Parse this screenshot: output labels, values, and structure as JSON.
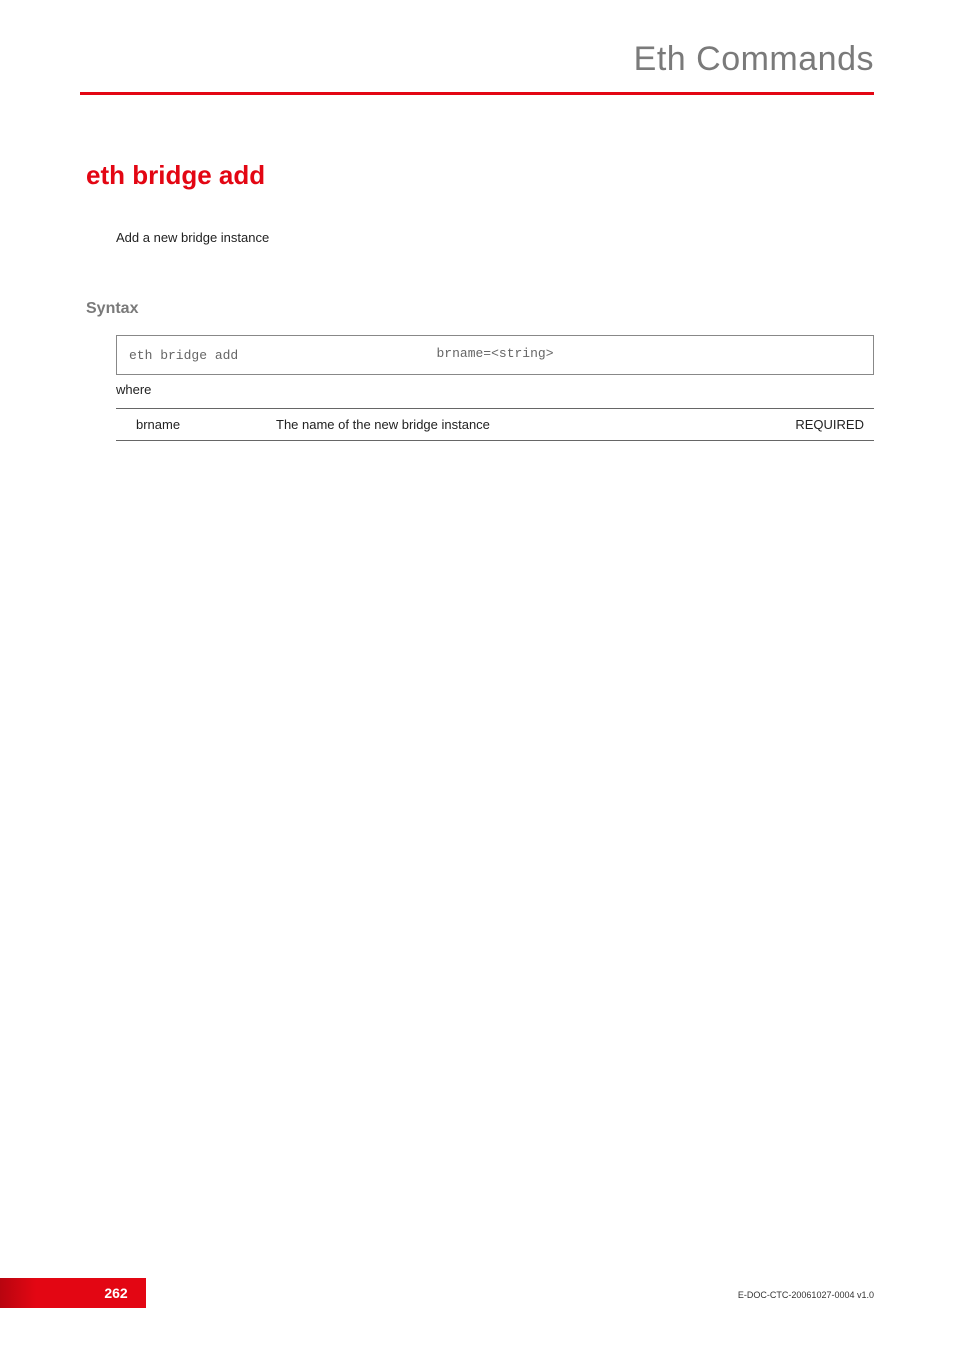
{
  "header": {
    "chapter_title": "Eth Commands"
  },
  "section": {
    "command_title": "eth bridge add",
    "description": "Add a new bridge instance"
  },
  "syntax": {
    "heading": "Syntax",
    "command": "eth bridge add",
    "argument": "brname=<string>",
    "where_label": "where"
  },
  "params": [
    {
      "name": "brname",
      "description": "The name of the new bridge instance",
      "requirement": "REQUIRED"
    }
  ],
  "footer": {
    "page_number": "262",
    "doc_id": "E-DOC-CTC-20061027-0004 v1.0"
  }
}
